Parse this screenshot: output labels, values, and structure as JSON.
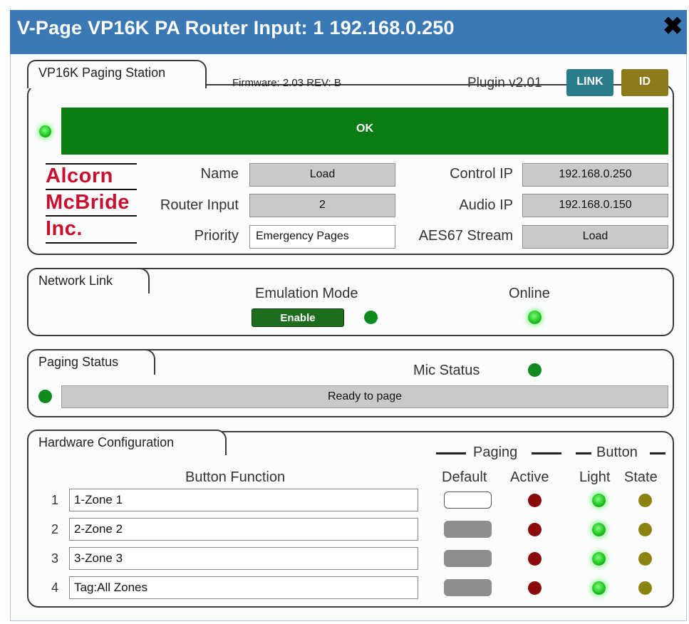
{
  "window": {
    "title": "V-Page VP16K PA Router Input: 1 192.168.0.250",
    "close_glyph": "✖"
  },
  "station": {
    "group_label": "VP16K Paging Station",
    "firmware": "Firmware: 2.03 REV: B",
    "plugin": "Plugin v2.01",
    "link_label": "LINK",
    "id_label": "ID",
    "status_text": "OK",
    "status_color": "#0a7d12",
    "logo_lines": [
      "Alcorn",
      "McBride",
      "Inc."
    ],
    "name_label": "Name",
    "name_value": "Load",
    "router_input_label": "Router Input",
    "router_input_value": "2",
    "priority_label": "Priority",
    "priority_value": "Emergency Pages",
    "control_ip_label": "Control IP",
    "control_ip_value": "192.168.0.250",
    "audio_ip_label": "Audio IP",
    "audio_ip_value": "192.168.0.150",
    "aes67_label": "AES67 Stream",
    "aes67_value": "Load"
  },
  "network": {
    "group_label": "Network Link",
    "emulation_label": "Emulation Mode",
    "enable_label": "Enable",
    "online_label": "Online"
  },
  "paging": {
    "group_label": "Paging Status",
    "mic_status_label": "Mic Status",
    "status_text": "Ready to page"
  },
  "hardware": {
    "group_label": "Hardware Configuration",
    "paging_header": "Paging",
    "button_header": "Button",
    "col_function": "Button Function",
    "col_default": "Default",
    "col_active": "Active",
    "col_light": "Light",
    "col_state": "State",
    "rows": [
      {
        "num": "1",
        "function": "1-Zone 1",
        "default_on": true
      },
      {
        "num": "2",
        "function": "2-Zone 2",
        "default_on": false
      },
      {
        "num": "3",
        "function": "3-Zone 3",
        "default_on": false
      },
      {
        "num": "4",
        "function": "Tag:All Zones",
        "default_on": false
      }
    ]
  },
  "colors": {
    "titlebar": "#3b79b5",
    "link_button": "#2b7d8c",
    "id_button": "#8c7a1a",
    "enable_button": "#1f6e1f",
    "led_green": "#0e8a1e",
    "led_red": "#8b0a0a",
    "led_olive": "#8c8412"
  }
}
